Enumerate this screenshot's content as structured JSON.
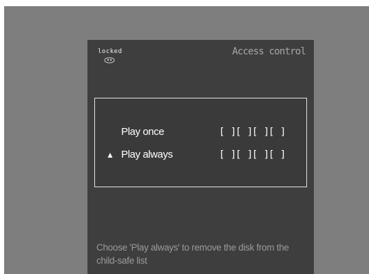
{
  "status": {
    "lock_label": "locked",
    "lock_icon": "lock-face-icon"
  },
  "title": "Access control",
  "options": [
    {
      "label": "Play once",
      "selected": false,
      "code_slots": [
        "[ ]",
        "[ ]",
        "[ ]",
        "[ ]"
      ]
    },
    {
      "label": "Play always",
      "selected": true,
      "marker": "▲",
      "code_slots": [
        "[ ]",
        "[ ]",
        "[ ]",
        "[ ]"
      ]
    }
  ],
  "hint": "Choose 'Play always' to remove the disk from the child-safe list",
  "colors": {
    "background": "#7e7e7e",
    "panel": "#3e3e3e",
    "title_text": "#a8a8a8",
    "hint_text": "#9a9a9a",
    "box_border": "#e6e6e6"
  }
}
